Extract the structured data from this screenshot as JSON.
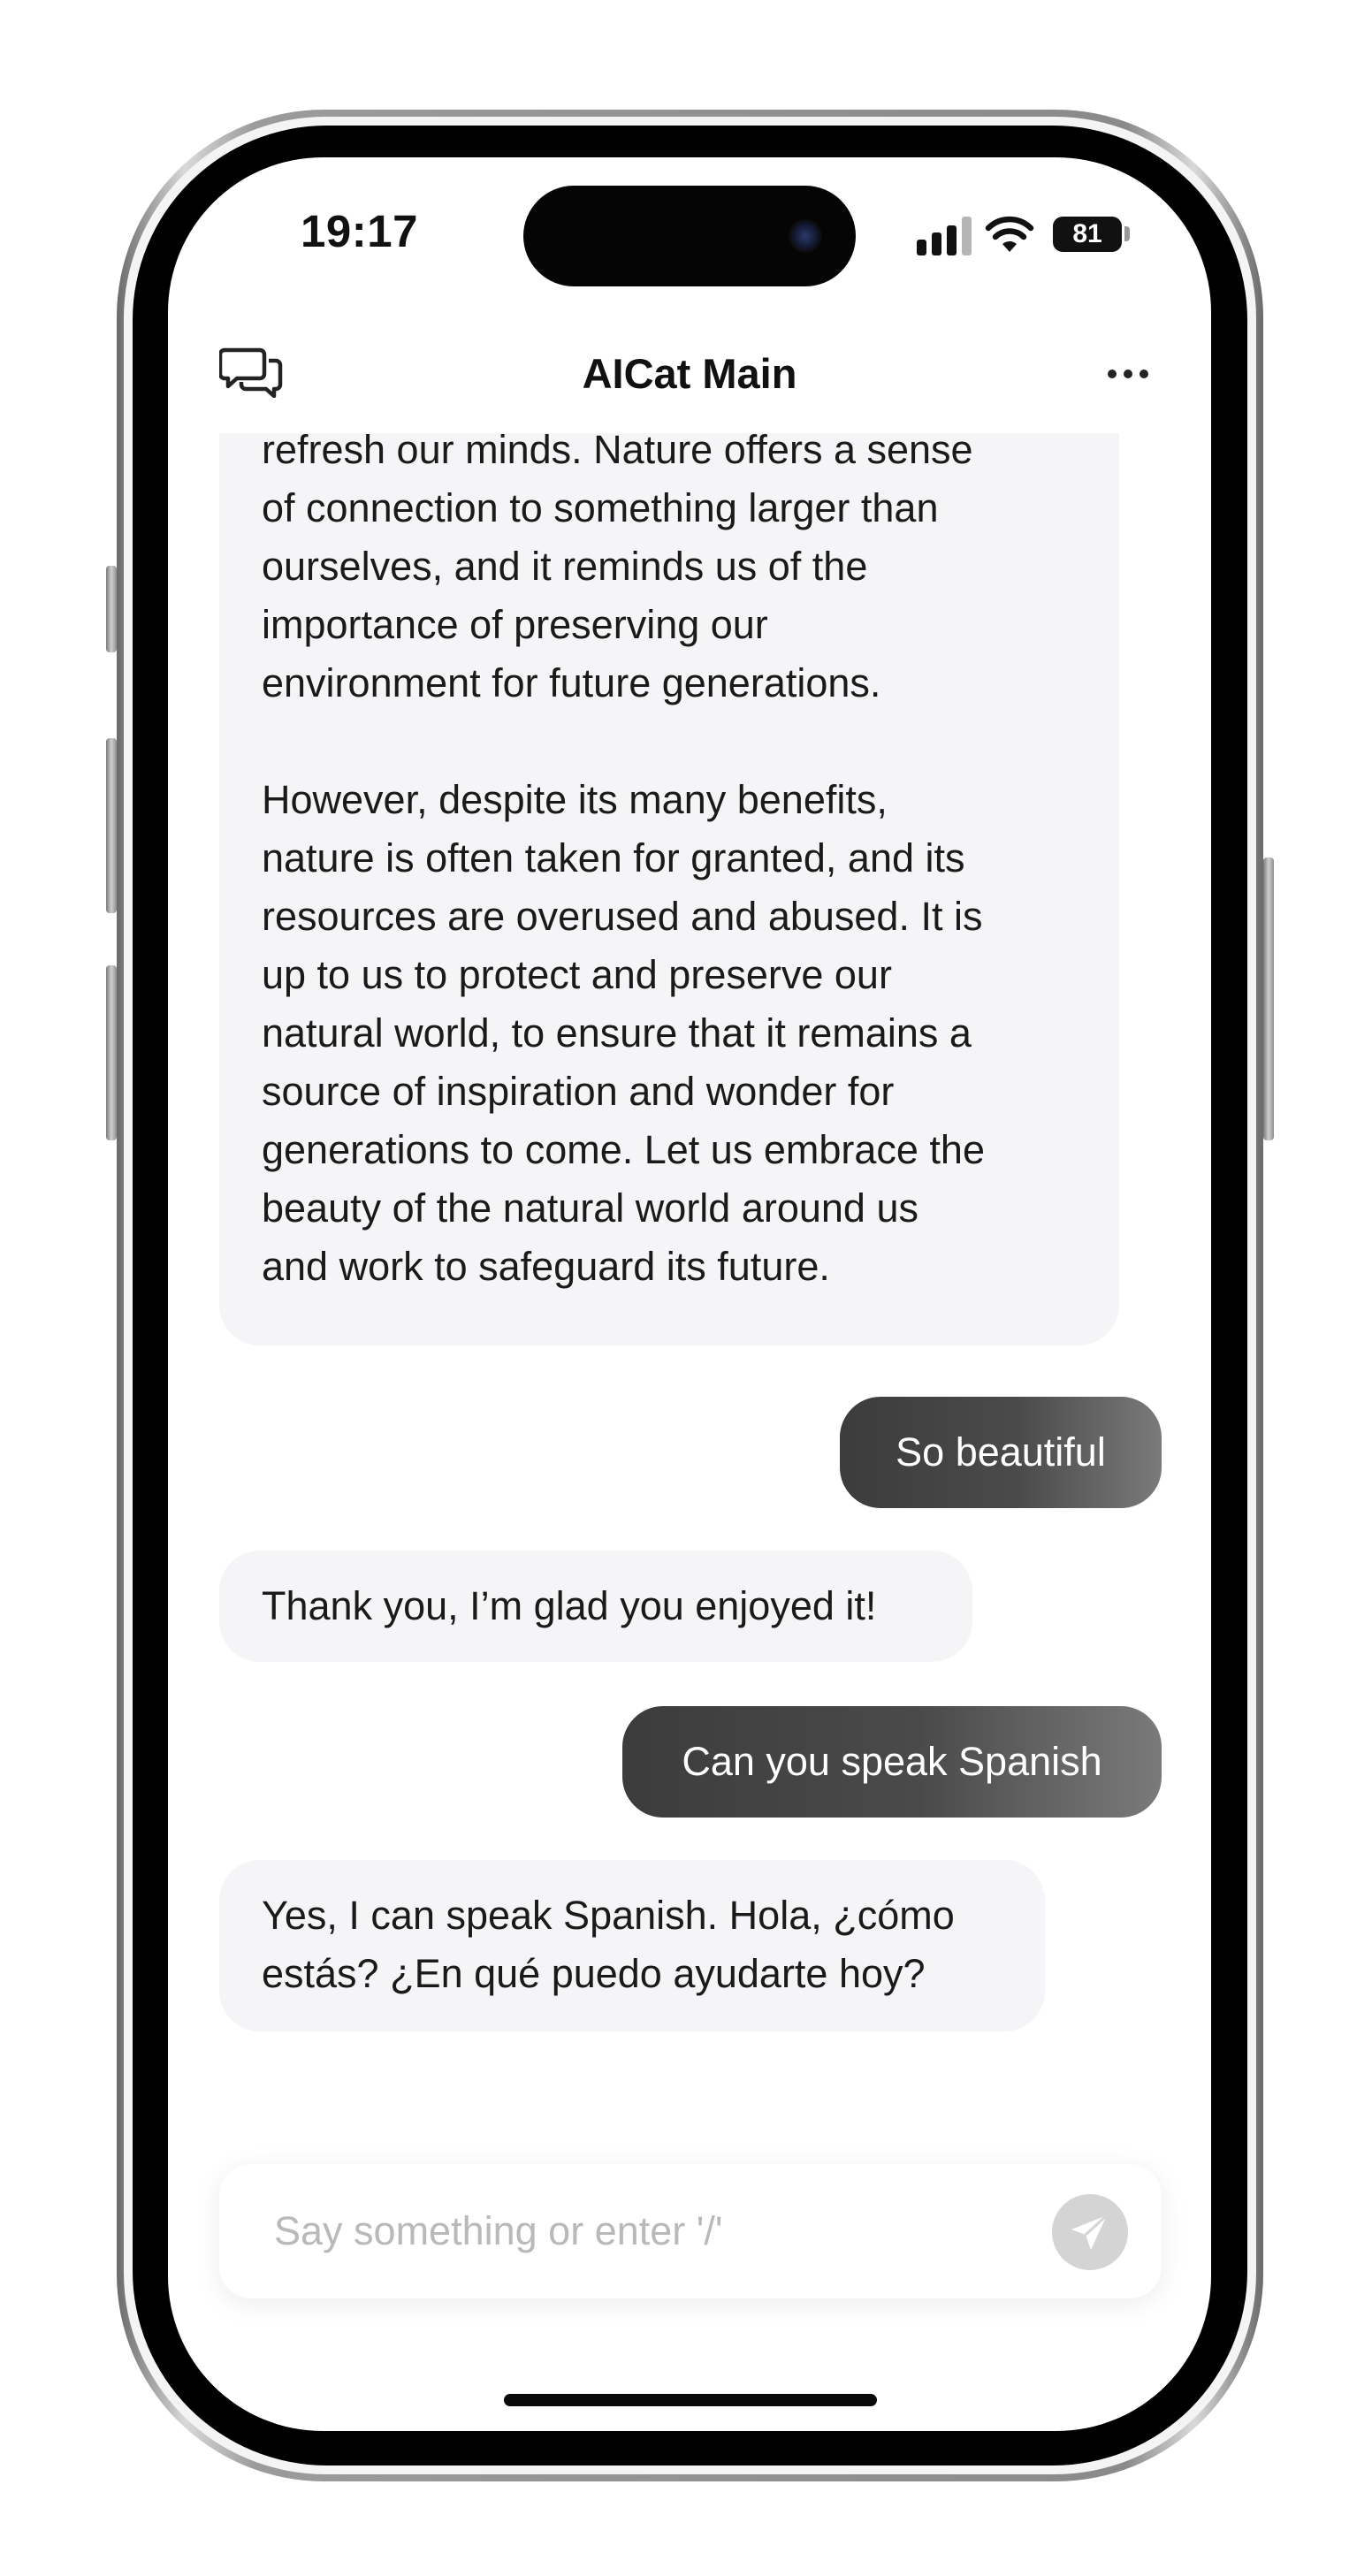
{
  "status_bar": {
    "time": "19:17",
    "battery": "81"
  },
  "header": {
    "title": "AICat Main"
  },
  "messages": [
    {
      "role": "assistant",
      "text": "of the waves can soothe our souls and\nrefresh our minds. Nature offers a sense\nof connection to something larger than\nourselves, and it reminds us of the\nimportance of preserving our\nenvironment for future generations.\n\nHowever, despite its many benefits,\nnature is often taken for granted, and its\nresources are overused and abused. It is\nup to us to protect and preserve our\nnatural world, to ensure that it remains a\nsource of inspiration and wonder for\ngenerations to come. Let us embrace the\nbeauty of the natural world around us\nand work to safeguard its future."
    },
    {
      "role": "user",
      "text": "So beautiful"
    },
    {
      "role": "assistant",
      "text": "Thank you, I’m glad you enjoyed it!"
    },
    {
      "role": "user",
      "text": "Can you speak Spanish"
    },
    {
      "role": "assistant",
      "text": "Yes, I can speak Spanish. Hola, ¿cómo\nestás? ¿En qué puedo ayudarte hoy?"
    }
  ],
  "composer": {
    "placeholder": "Say something or enter '/'"
  },
  "icons": {
    "chat_list": "chat-bubbles-icon",
    "more": "more-dots-icon",
    "send": "send-icon",
    "signal": "cellular-signal-icon",
    "wifi": "wifi-icon",
    "battery": "battery-icon"
  },
  "colors": {
    "ai_bubble": "#f5f5f7",
    "user_bubble_start": "#3c3c3c",
    "user_bubble_end": "#7a7a7a",
    "send_button": "#d4d4d4",
    "placeholder": "#b9b9b9"
  }
}
